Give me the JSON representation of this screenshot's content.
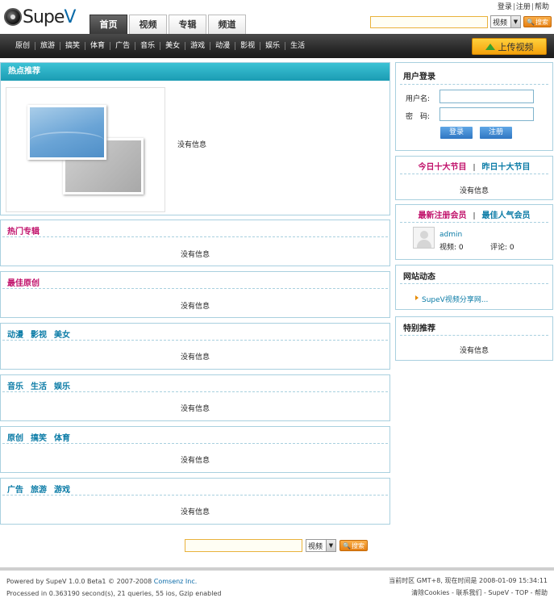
{
  "brand": {
    "logo_text_a": "Supe",
    "logo_text_b": "V"
  },
  "toplinks": {
    "login": "登录",
    "register": "注册",
    "help": "帮助",
    "sep": "|"
  },
  "tabs": [
    {
      "label": "首页",
      "active": true
    },
    {
      "label": "视频",
      "active": false
    },
    {
      "label": "专辑",
      "active": false
    },
    {
      "label": "频道",
      "active": false
    }
  ],
  "search": {
    "select_value": "视频",
    "button": "搜索",
    "input_value": ""
  },
  "nav": {
    "items": [
      "原创",
      "旅游",
      "搞笑",
      "体育",
      "广告",
      "音乐",
      "美女",
      "游戏",
      "动漫",
      "影视",
      "娱乐",
      "生活"
    ],
    "upload_label": "上传视频"
  },
  "hot": {
    "title": "热点推荐",
    "empty": "没有信息"
  },
  "sections": [
    {
      "titles": [
        "热门专辑"
      ],
      "color": "red",
      "empty": "没有信息"
    },
    {
      "titles": [
        "最佳原创"
      ],
      "color": "red",
      "empty": "没有信息"
    },
    {
      "titles": [
        "动漫",
        "影视",
        "美女"
      ],
      "color": "blue",
      "empty": "没有信息"
    },
    {
      "titles": [
        "音乐",
        "生活",
        "娱乐"
      ],
      "color": "blue",
      "empty": "没有信息"
    },
    {
      "titles": [
        "原创",
        "搞笑",
        "体育"
      ],
      "color": "blue",
      "empty": "没有信息"
    },
    {
      "titles": [
        "广告",
        "旅游",
        "游戏"
      ],
      "color": "blue",
      "empty": "没有信息"
    }
  ],
  "login": {
    "title": "用户登录",
    "username_label": "用户名:",
    "password_label": "密　码:",
    "login_button": "登录",
    "register_button": "注册"
  },
  "top10": {
    "today": "今日十大节目",
    "yesterday": "昨日十大节目",
    "sep": "|",
    "empty": "没有信息"
  },
  "members": {
    "newest": "最新注册会员",
    "popular": "最佳人气会员",
    "sep": "|",
    "user": {
      "name": "admin",
      "videos_label": "视频: 0",
      "comments_label": "评论: 0"
    }
  },
  "news": {
    "title": "网站动态",
    "item": "SupeV视频分享网..."
  },
  "special": {
    "title": "特别推荐",
    "empty": "没有信息"
  },
  "footer": {
    "powered_prefix": "Powered by SupeV 1.0.0 Beta1 © 2007-2008",
    "company": "Comsenz Inc.",
    "processed": "Processed in 0.363190 second(s), 21 queries, 55 ios, Gzip enabled",
    "timezone": "当前时区 GMT+8, 现在时间是 2008-01-09 15:34:11",
    "links": "清除Cookies - 联系我们 - SupeV - TOP - 帮助"
  },
  "colors": {
    "accent_teal": "#1b9cb3",
    "pink": "#c0106a",
    "link_blue": "#0a7ba6",
    "upload_orange": "#f4a10b"
  }
}
